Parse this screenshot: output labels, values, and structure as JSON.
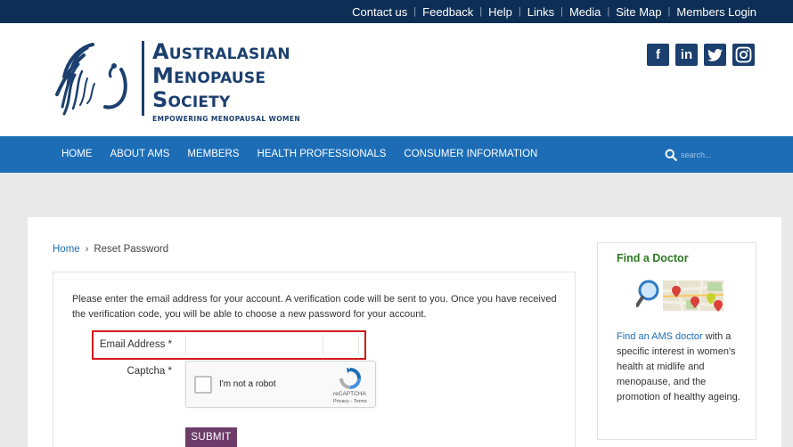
{
  "topbar": {
    "links": [
      "Contact us",
      "Feedback",
      "Help",
      "Links",
      "Media",
      "Site Map",
      "Members Login"
    ]
  },
  "logo": {
    "line1_cap": "A",
    "line1_rest": "USTRALASIAN",
    "line2_cap": "M",
    "line2_rest": "ENOPAUSE",
    "line3_cap": "S",
    "line3_rest": "OCIETY",
    "tagline": "EMPOWERING MENOPAUSAL WOMEN"
  },
  "social": {
    "facebook": "f",
    "linkedin": "in"
  },
  "nav": {
    "items": [
      "HOME",
      "ABOUT AMS",
      "MEMBERS",
      "HEALTH PROFESSIONALS",
      "CONSUMER INFORMATION"
    ],
    "search_placeholder": "search..."
  },
  "breadcrumb": {
    "home": "Home",
    "separator": "›",
    "current": "Reset Password"
  },
  "form": {
    "intro": "Please enter the email address for your account. A verification code will be sent to you. Once you have received the verification code, you will be able to choose a new password for your account.",
    "email_label": "Email Address *",
    "email_value": "",
    "captcha_label": "Captcha *",
    "recaptcha_checkbox_label": "I'm not a robot",
    "recaptcha_brand": "reCAPTCHA",
    "recaptcha_terms": "Privacy - Terms",
    "submit_label": "SUBMIT"
  },
  "sidebar": {
    "title": "Find a Doctor",
    "link_text": "Find an AMS doctor",
    "body_text": " with a specific interest in women's health at midlife and menopause, and the promotion of healthy ageing."
  },
  "colors": {
    "topbar": "#0e2f55",
    "nav": "#1c6db6",
    "brand_navy": "#1b3f6e",
    "submit": "#6d3c6a",
    "sidebar_title": "#2d7a21",
    "highlight": "#d6191b"
  },
  "icons": {
    "search": "search-icon",
    "facebook": "facebook-icon",
    "linkedin": "linkedin-icon",
    "twitter": "twitter-icon",
    "instagram": "instagram-icon",
    "breadcrumb_sep": "chevron-right-icon",
    "recaptcha": "recaptcha-logo-icon",
    "find_doctor": "map-search-icon"
  }
}
